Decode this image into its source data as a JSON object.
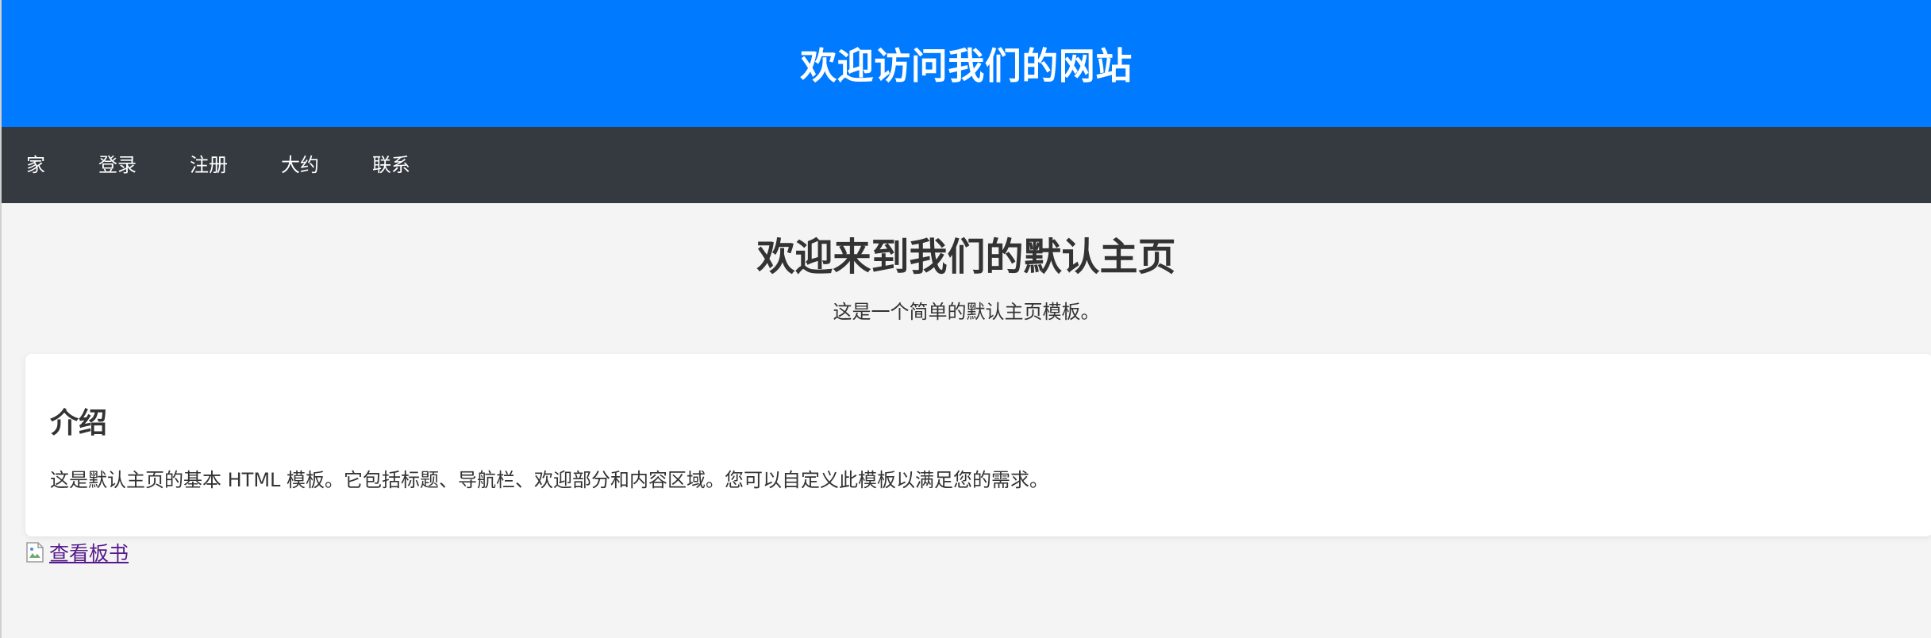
{
  "header": {
    "title": "欢迎访问我们的网站",
    "background_color": "#007bff"
  },
  "nav": {
    "background_color": "#343a40",
    "items": [
      {
        "label": "家"
      },
      {
        "label": "登录"
      },
      {
        "label": "注册"
      },
      {
        "label": "大约"
      },
      {
        "label": "联系"
      }
    ]
  },
  "welcome": {
    "title": "欢迎来到我们的默认主页",
    "subtitle": "这是一个简单的默认主页模板。"
  },
  "intro": {
    "title": "介绍",
    "text": "这是默认主页的基本 HTML 模板。它包括标题、导航栏、欢迎部分和内容区域。您可以自定义此模板以满足您的需求。"
  },
  "board_link": {
    "icon": "broken-image-icon",
    "label": "查看板书"
  }
}
